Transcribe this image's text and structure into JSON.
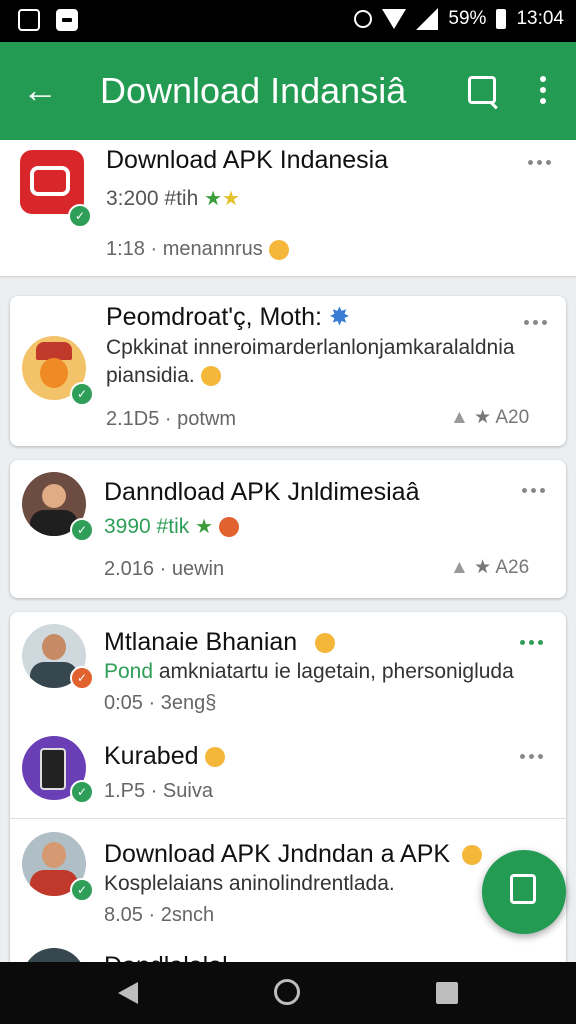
{
  "status": {
    "battery": "59%",
    "time": "13:04"
  },
  "appbar": {
    "back_glyph": "←",
    "title": "Download Indansiâ"
  },
  "items": [
    {
      "title": "Download APK Indanesia",
      "sub": "3:200 #tih",
      "meta": "1:18 · ",
      "meta2": "menannrus"
    },
    {
      "title": "Peomdroat'ç, Moth:",
      "sub": "Cpkkinat inneroimarderlanlonjamkaralaldnia",
      "sub2": "piansidia.",
      "meta": "2.1D5 · potwm",
      "rating": "A20"
    },
    {
      "title": "Danndload APK Jnldimesiaâ",
      "sub": "3990 #tik",
      "meta": "2.016 · uewin",
      "rating": "A26"
    },
    {
      "title": "Mtlanaie Bhanian",
      "sub_green": "Pond",
      "sub": " amkniatartu ie lagetain, phersonigluda",
      "meta": "0:05 · 3eng§"
    },
    {
      "title": "Kurabed",
      "meta": "1.P5 · Suiva"
    },
    {
      "title": "Download APK Jndndan a APK",
      "sub": "Kosplelaians aninolindrentlada.",
      "meta": "8.05 · 2snch"
    },
    {
      "title": "Dandlalalal"
    }
  ],
  "icons": {
    "accent": "#249b53",
    "green": "#2e9e58"
  }
}
